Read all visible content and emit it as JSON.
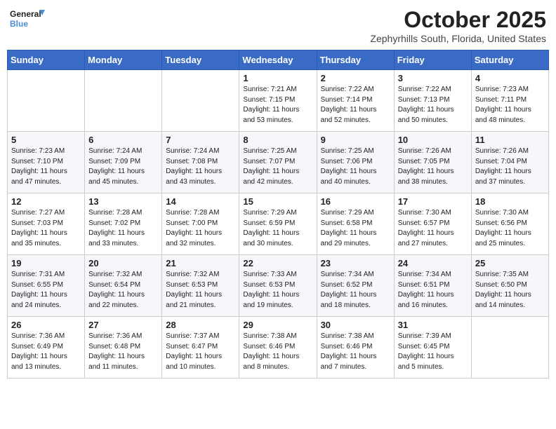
{
  "header": {
    "logo_line1": "General",
    "logo_line2": "Blue",
    "month": "October 2025",
    "location": "Zephyrhills South, Florida, United States"
  },
  "weekdays": [
    "Sunday",
    "Monday",
    "Tuesday",
    "Wednesday",
    "Thursday",
    "Friday",
    "Saturday"
  ],
  "weeks": [
    [
      {
        "day": "",
        "info": ""
      },
      {
        "day": "",
        "info": ""
      },
      {
        "day": "",
        "info": ""
      },
      {
        "day": "1",
        "info": "Sunrise: 7:21 AM\nSunset: 7:15 PM\nDaylight: 11 hours\nand 53 minutes."
      },
      {
        "day": "2",
        "info": "Sunrise: 7:22 AM\nSunset: 7:14 PM\nDaylight: 11 hours\nand 52 minutes."
      },
      {
        "day": "3",
        "info": "Sunrise: 7:22 AM\nSunset: 7:13 PM\nDaylight: 11 hours\nand 50 minutes."
      },
      {
        "day": "4",
        "info": "Sunrise: 7:23 AM\nSunset: 7:11 PM\nDaylight: 11 hours\nand 48 minutes."
      }
    ],
    [
      {
        "day": "5",
        "info": "Sunrise: 7:23 AM\nSunset: 7:10 PM\nDaylight: 11 hours\nand 47 minutes."
      },
      {
        "day": "6",
        "info": "Sunrise: 7:24 AM\nSunset: 7:09 PM\nDaylight: 11 hours\nand 45 minutes."
      },
      {
        "day": "7",
        "info": "Sunrise: 7:24 AM\nSunset: 7:08 PM\nDaylight: 11 hours\nand 43 minutes."
      },
      {
        "day": "8",
        "info": "Sunrise: 7:25 AM\nSunset: 7:07 PM\nDaylight: 11 hours\nand 42 minutes."
      },
      {
        "day": "9",
        "info": "Sunrise: 7:25 AM\nSunset: 7:06 PM\nDaylight: 11 hours\nand 40 minutes."
      },
      {
        "day": "10",
        "info": "Sunrise: 7:26 AM\nSunset: 7:05 PM\nDaylight: 11 hours\nand 38 minutes."
      },
      {
        "day": "11",
        "info": "Sunrise: 7:26 AM\nSunset: 7:04 PM\nDaylight: 11 hours\nand 37 minutes."
      }
    ],
    [
      {
        "day": "12",
        "info": "Sunrise: 7:27 AM\nSunset: 7:03 PM\nDaylight: 11 hours\nand 35 minutes."
      },
      {
        "day": "13",
        "info": "Sunrise: 7:28 AM\nSunset: 7:02 PM\nDaylight: 11 hours\nand 33 minutes."
      },
      {
        "day": "14",
        "info": "Sunrise: 7:28 AM\nSunset: 7:00 PM\nDaylight: 11 hours\nand 32 minutes."
      },
      {
        "day": "15",
        "info": "Sunrise: 7:29 AM\nSunset: 6:59 PM\nDaylight: 11 hours\nand 30 minutes."
      },
      {
        "day": "16",
        "info": "Sunrise: 7:29 AM\nSunset: 6:58 PM\nDaylight: 11 hours\nand 29 minutes."
      },
      {
        "day": "17",
        "info": "Sunrise: 7:30 AM\nSunset: 6:57 PM\nDaylight: 11 hours\nand 27 minutes."
      },
      {
        "day": "18",
        "info": "Sunrise: 7:30 AM\nSunset: 6:56 PM\nDaylight: 11 hours\nand 25 minutes."
      }
    ],
    [
      {
        "day": "19",
        "info": "Sunrise: 7:31 AM\nSunset: 6:55 PM\nDaylight: 11 hours\nand 24 minutes."
      },
      {
        "day": "20",
        "info": "Sunrise: 7:32 AM\nSunset: 6:54 PM\nDaylight: 11 hours\nand 22 minutes."
      },
      {
        "day": "21",
        "info": "Sunrise: 7:32 AM\nSunset: 6:53 PM\nDaylight: 11 hours\nand 21 minutes."
      },
      {
        "day": "22",
        "info": "Sunrise: 7:33 AM\nSunset: 6:53 PM\nDaylight: 11 hours\nand 19 minutes."
      },
      {
        "day": "23",
        "info": "Sunrise: 7:34 AM\nSunset: 6:52 PM\nDaylight: 11 hours\nand 18 minutes."
      },
      {
        "day": "24",
        "info": "Sunrise: 7:34 AM\nSunset: 6:51 PM\nDaylight: 11 hours\nand 16 minutes."
      },
      {
        "day": "25",
        "info": "Sunrise: 7:35 AM\nSunset: 6:50 PM\nDaylight: 11 hours\nand 14 minutes."
      }
    ],
    [
      {
        "day": "26",
        "info": "Sunrise: 7:36 AM\nSunset: 6:49 PM\nDaylight: 11 hours\nand 13 minutes."
      },
      {
        "day": "27",
        "info": "Sunrise: 7:36 AM\nSunset: 6:48 PM\nDaylight: 11 hours\nand 11 minutes."
      },
      {
        "day": "28",
        "info": "Sunrise: 7:37 AM\nSunset: 6:47 PM\nDaylight: 11 hours\nand 10 minutes."
      },
      {
        "day": "29",
        "info": "Sunrise: 7:38 AM\nSunset: 6:46 PM\nDaylight: 11 hours\nand 8 minutes."
      },
      {
        "day": "30",
        "info": "Sunrise: 7:38 AM\nSunset: 6:46 PM\nDaylight: 11 hours\nand 7 minutes."
      },
      {
        "day": "31",
        "info": "Sunrise: 7:39 AM\nSunset: 6:45 PM\nDaylight: 11 hours\nand 5 minutes."
      },
      {
        "day": "",
        "info": ""
      }
    ]
  ]
}
